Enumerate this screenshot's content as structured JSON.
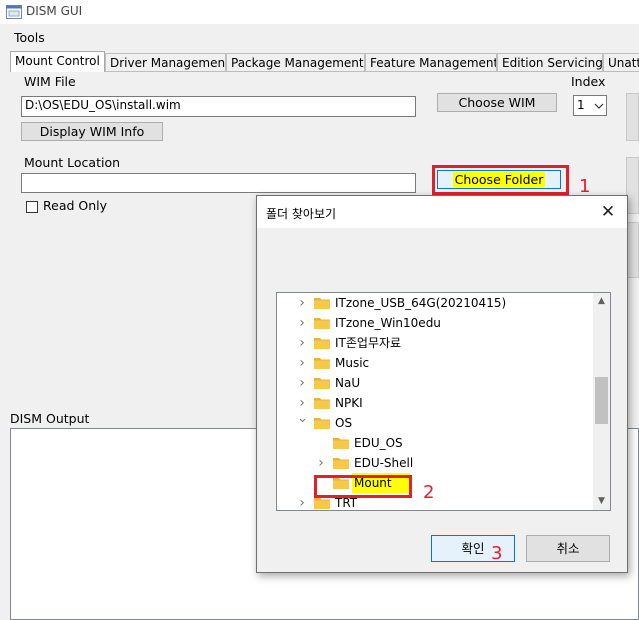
{
  "window": {
    "title": "DISM GUI"
  },
  "menu": {
    "tools": "Tools"
  },
  "tabs": [
    {
      "label": "Mount Control",
      "active": true
    },
    {
      "label": "Driver Management"
    },
    {
      "label": "Package Management"
    },
    {
      "label": "Feature Management"
    },
    {
      "label": "Edition Servicing"
    },
    {
      "label": "Unatte"
    }
  ],
  "mount": {
    "wim_file_label": "WIM File",
    "wim_file_value": "D:\\OS\\EDU_OS\\install.wim",
    "choose_wim": "Choose WIM",
    "index_label": "Index",
    "index_value": "1",
    "display_wim_info": "Display WIM Info",
    "mount_location_label": "Mount Location",
    "mount_location_value": "",
    "choose_folder": "Choose Folder",
    "read_only": "Read Only"
  },
  "output": {
    "label": "DISM Output"
  },
  "dialog": {
    "title": "폴더 찾아보기",
    "ok": "확인",
    "cancel": "취소",
    "tree": [
      {
        "name": "ITzone_USB_64G(20210415)",
        "level": 1,
        "expander": "collapsed"
      },
      {
        "name": "ITzone_Win10edu",
        "level": 1,
        "expander": "collapsed"
      },
      {
        "name": "IT존업무자료",
        "level": 1,
        "expander": "collapsed"
      },
      {
        "name": "Music",
        "level": 1,
        "expander": "collapsed"
      },
      {
        "name": "NaU",
        "level": 1,
        "expander": "collapsed"
      },
      {
        "name": "NPKI",
        "level": 1,
        "expander": "collapsed"
      },
      {
        "name": "OS",
        "level": 1,
        "expander": "expanded"
      },
      {
        "name": "EDU_OS",
        "level": 2,
        "expander": "none"
      },
      {
        "name": "EDU-Shell",
        "level": 2,
        "expander": "collapsed"
      },
      {
        "name": "Mount",
        "level": 2,
        "expander": "none",
        "selected": true
      },
      {
        "name": "TRT",
        "level": 1,
        "expander": "collapsed"
      }
    ]
  },
  "annotations": {
    "step1": "1",
    "step2": "2",
    "step3": "3"
  },
  "colors": {
    "highlight": "#ffff00",
    "annotation": "#e2202a",
    "folder": "#f6c94a"
  }
}
